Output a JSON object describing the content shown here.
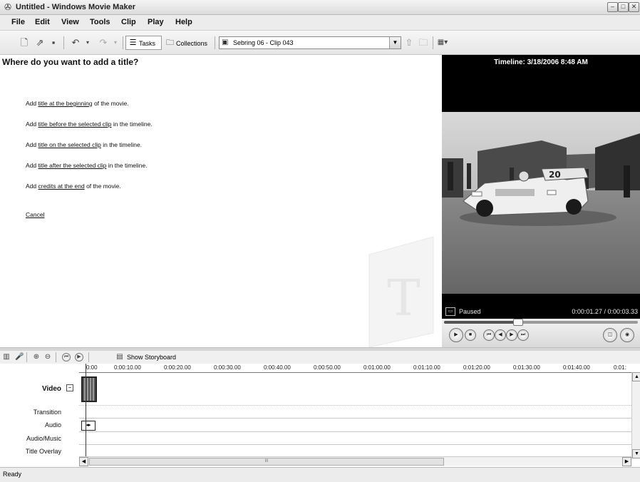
{
  "window": {
    "title": "Untitled - Windows Movie Maker",
    "app_icon": "movie-maker-icon",
    "controls": [
      "minimize",
      "maximize",
      "close"
    ]
  },
  "menu": [
    "File",
    "Edit",
    "View",
    "Tools",
    "Clip",
    "Play",
    "Help"
  ],
  "toolbar": {
    "tasks_label": "Tasks",
    "collections_label": "Collections",
    "collection_selected": "Sebring 06 - Clip 043",
    "icons": [
      "new-project-icon",
      "open-project-icon",
      "save-project-icon",
      "undo-icon",
      "redo-icon",
      "up-level-icon",
      "new-folder-icon",
      "views-icon"
    ]
  },
  "task_pane": {
    "heading": "Where do you want to add a title?",
    "options": [
      {
        "prefix": "Add ",
        "link": "title at the beginning",
        "suffix": " of the movie."
      },
      {
        "prefix": "Add ",
        "link": "title before the selected clip",
        "suffix": " in the timeline."
      },
      {
        "prefix": "Add ",
        "link": "title on the selected clip",
        "suffix": " in the timeline."
      },
      {
        "prefix": "Add ",
        "link": "title after the selected clip",
        "suffix": " in the timeline."
      },
      {
        "prefix": "Add ",
        "link": "credits at the end",
        "suffix": " of the movie."
      }
    ],
    "cancel": "Cancel"
  },
  "preview": {
    "heading": "Timeline: 3/18/2006 8:48 AM",
    "status": "Paused",
    "time": "0:00:01.27 / 0:00:03.33",
    "position_fraction": 0.38
  },
  "timeline": {
    "show_storyboard": "Show Storyboard",
    "ruler_ticks": [
      "0:00",
      "0:00:10.00",
      "0:00:20.00",
      "0:00:30.00",
      "0:00:40.00",
      "0:00:50.00",
      "0:01:00.00",
      "0:01:10.00",
      "0:01:20.00",
      "0:01:30.00",
      "0:01:40.00",
      "0:01:"
    ],
    "tracks": {
      "video": "Video",
      "transition": "Transition",
      "audio": "Audio",
      "audio_music": "Audio/Music",
      "title_overlay": "Title Overlay"
    },
    "scroll_mark": "III"
  },
  "status": "Ready",
  "colors": {
    "preview_bg": "#000000",
    "pane_bg": "#ffffff"
  }
}
